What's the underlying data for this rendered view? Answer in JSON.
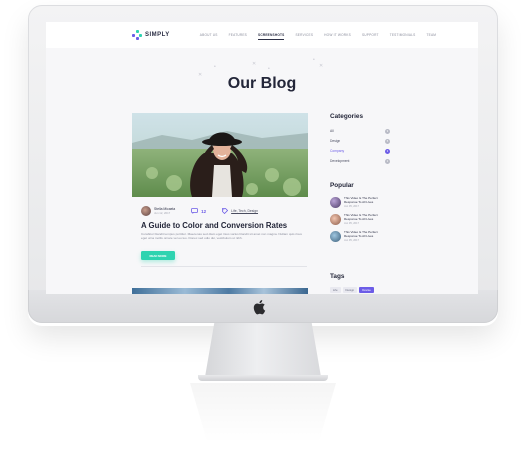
{
  "nav": {
    "logo": "SIMPLY",
    "links": [
      "ABOUT US",
      "FEATURES",
      "SCREENSHOTS",
      "SERVICES",
      "HOW IT WORKS",
      "SUPPORT",
      "TESTIMONIALS",
      "TEAM"
    ],
    "active_index": 2
  },
  "page_title": "Our Blog",
  "post": {
    "author": "Stella Micaela",
    "date": "Jun 12, 2017",
    "comments": "12",
    "categories": "Life, Tech, Design",
    "title": "A Guide to Color and Conversion Rates",
    "excerpt": "Curabitur blandit tempus porttitor. Maecenas sed diam eget risus varius blandit sit amet non magna. Nullam quis risus eget urna mollis ornare vel eu leo. Donec sed odio dui, vestibulum ut nibh.",
    "read_more": "READ MORE"
  },
  "sidebar": {
    "categories_heading": "Categories",
    "categories": [
      {
        "label": "All",
        "count": "9"
      },
      {
        "label": "Design",
        "count": "5"
      },
      {
        "label": "Company",
        "count": "3"
      },
      {
        "label": "Development",
        "count": "2"
      }
    ],
    "active_category": 2,
    "popular_heading": "Popular",
    "popular": [
      {
        "title": "This Video Is The Perfect Response To All Lives",
        "date": "Jun 05, 2017"
      },
      {
        "title": "This Video Is The Perfect Response To All Lives",
        "date": "Jun 05, 2017"
      },
      {
        "title": "This Video Is The Perfect Response To All Lives",
        "date": "Jun 05, 2017"
      }
    ],
    "tags_heading": "Tags",
    "tags": [
      "Life",
      "Design",
      "Devise"
    ],
    "active_tag": 2
  },
  "colors": {
    "accent": "#6c5ce7",
    "button": "#2ed3b0",
    "heading": "#232639"
  }
}
